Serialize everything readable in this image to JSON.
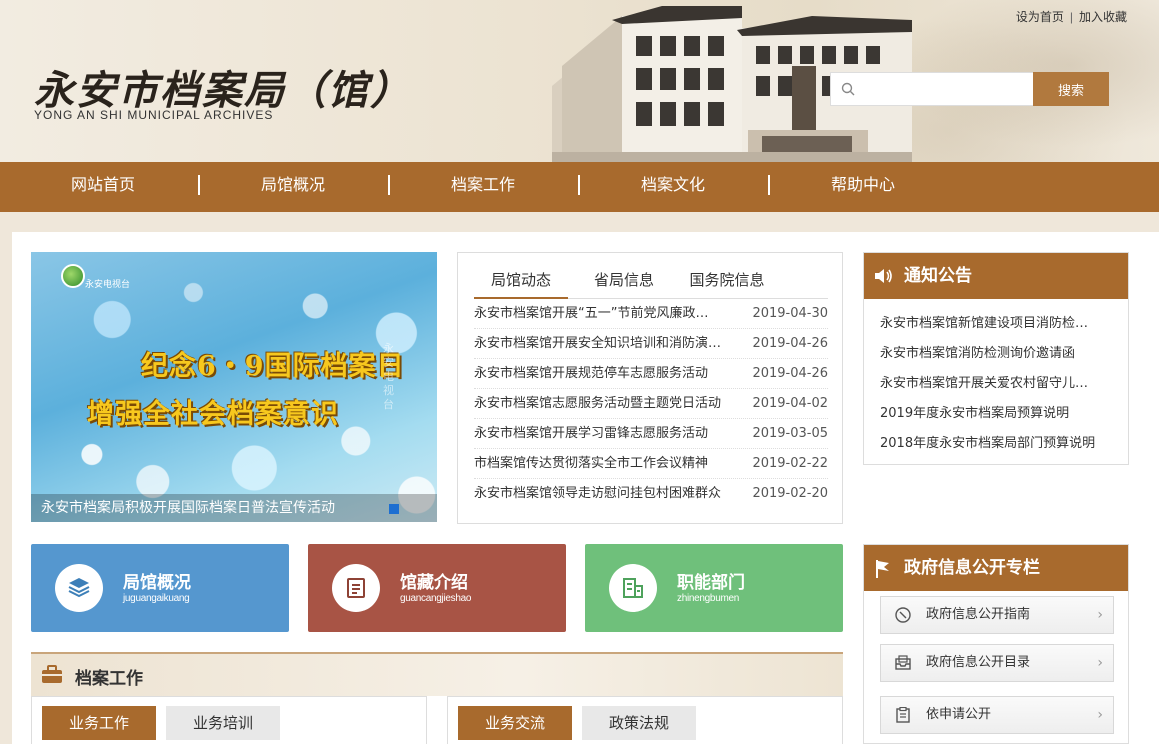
{
  "header": {
    "logo_cn": "永安市档案局（馆）",
    "logo_en": "YONG AN SHI  MUNICIPAL  ARCHIVES",
    "top_links": [
      "设为首页",
      "加入收藏"
    ],
    "search_placeholder": "",
    "search_button": "搜索"
  },
  "nav": [
    "网站首页",
    "局馆概况",
    "档案工作",
    "档案文化",
    "帮助中心"
  ],
  "slider": {
    "tv_logo_text": "永安电视台",
    "headline_1": "纪念6・9国际档案日",
    "headline_2": "增强全社会档案意识",
    "watermark": "永安电视台",
    "caption": "永安市档案局积极开展国际档案日普法宣传活动"
  },
  "news": {
    "tabs": [
      "局馆动态",
      "省局信息",
      "国务院信息"
    ],
    "items": [
      {
        "title": "永安市档案馆开展“五一”节前党风廉政…",
        "date": "2019-04-30"
      },
      {
        "title": "永安市档案馆开展安全知识培训和消防演…",
        "date": "2019-04-26"
      },
      {
        "title": "永安市档案馆开展规范停车志愿服务活动",
        "date": "2019-04-26"
      },
      {
        "title": "永安市档案馆志愿服务活动暨主题党日活动",
        "date": "2019-04-02"
      },
      {
        "title": "永安市档案馆开展学习雷锋志愿服务活动",
        "date": "2019-03-05"
      },
      {
        "title": "市档案馆传达贯彻落实全市工作会议精神",
        "date": "2019-02-22"
      },
      {
        "title": "永安市档案馆领导走访慰问挂包村困难群众",
        "date": "2019-02-20"
      }
    ]
  },
  "notice": {
    "title": "通知公告",
    "items": [
      "永安市档案馆新馆建设项目消防检…",
      "永安市档案馆消防检测询价邀请函",
      "永安市档案馆开展关爱农村留守儿…",
      "2019年度永安市档案局预算说明",
      "2018年度永安市档案局部门预算说明"
    ]
  },
  "tiles": [
    {
      "name": "局馆概况",
      "sub": "juguangaikuang",
      "color": "#5597cf"
    },
    {
      "name": "馆藏介绍",
      "sub": "guancangjieshao",
      "color": "#a85445"
    },
    {
      "name": "职能部门",
      "sub": "zhinengbumen",
      "color": "#6fc07b"
    }
  ],
  "gov": {
    "title": "政府信息公开专栏",
    "items": [
      "政府信息公开指南",
      "政府信息公开目录",
      "依申请公开"
    ]
  },
  "work": {
    "title": "档案工作",
    "left_tabs": [
      "业务工作",
      "业务培训"
    ],
    "right_tabs": [
      "业务交流",
      "政策法规"
    ]
  },
  "colors": {
    "brand": "#a86a2d",
    "search_button": "#b1793e"
  }
}
